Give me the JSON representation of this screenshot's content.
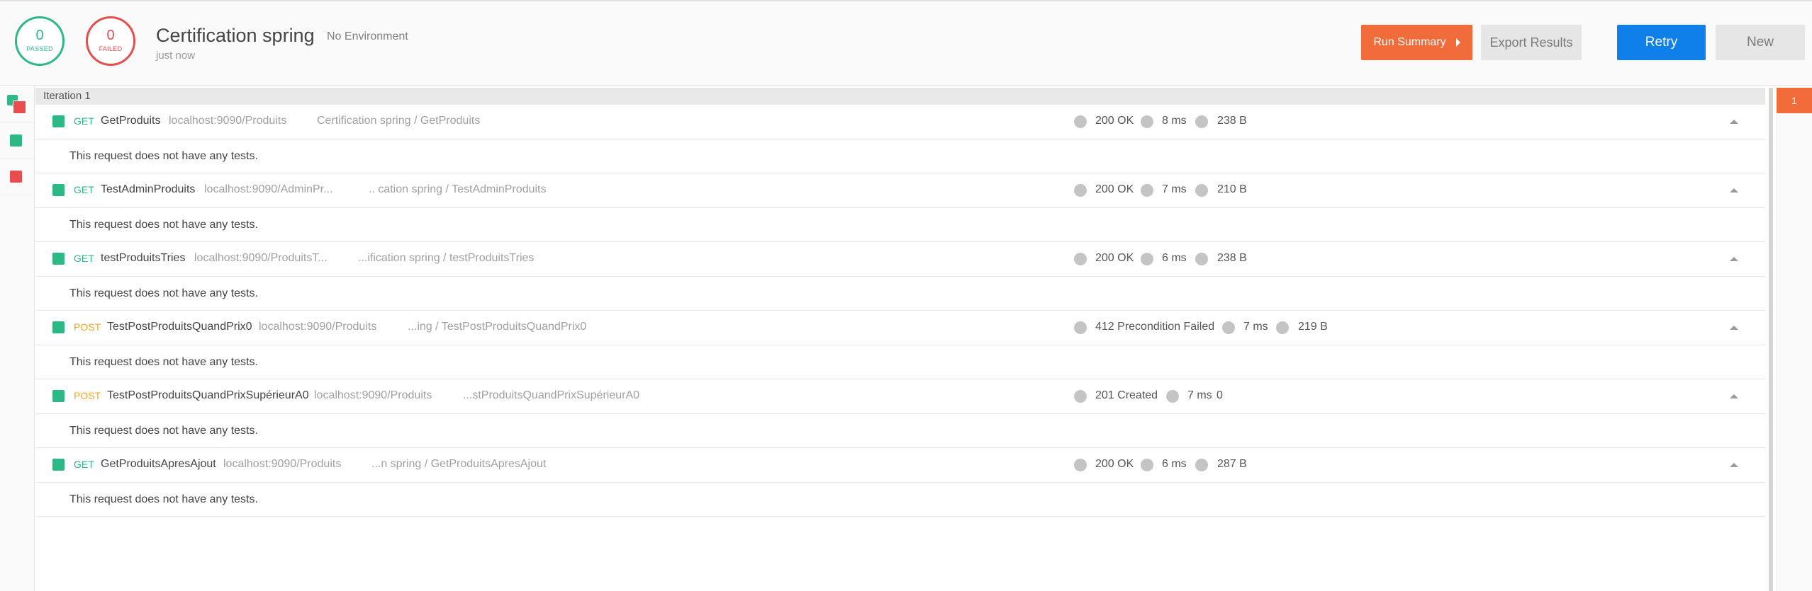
{
  "summary": {
    "passed_count": "0",
    "passed_label": "PASSED",
    "failed_count": "0",
    "failed_label": "FAILED",
    "title": "Certification spring",
    "environment": "No Environment",
    "time": "just now"
  },
  "toolbar": {
    "run_summary": "Run Summary",
    "export_results": "Export Results",
    "retry": "Retry",
    "new": "New"
  },
  "iteration": {
    "label": "Iteration 1",
    "badge": "1"
  },
  "requests": [
    {
      "method": "GET",
      "name": "GetProduits",
      "url": "localhost:9090/Produits",
      "path": "Certification spring / GetProduits",
      "status": "200 OK",
      "time": "8 ms",
      "size": "238 B",
      "message": "This request does not have any tests."
    },
    {
      "method": "GET",
      "name": "TestAdminProduits",
      "url": "localhost:9090/AdminPr...",
      "path": ".. cation spring / TestAdminProduits",
      "status": "200 OK",
      "time": "7 ms",
      "size": "210 B",
      "message": "This request does not have any tests."
    },
    {
      "method": "GET",
      "name": "testProduitsTries",
      "url": "localhost:9090/ProduitsT...",
      "path": "...ification spring / testProduitsTries",
      "status": "200 OK",
      "time": "6 ms",
      "size": "238 B",
      "message": "This request does not have any tests."
    },
    {
      "method": "POST",
      "name": "TestPostProduitsQuandPrix0",
      "url": "localhost:9090/Produits",
      "path": "...ing / TestPostProduitsQuandPrix0",
      "status": "412 Precondition Failed",
      "time": "7 ms",
      "size": "219 B",
      "message": "This request does not have any tests."
    },
    {
      "method": "POST",
      "name": "TestPostProduitsQuandPrixSupérieurA0",
      "url": "localhost:9090/Produits",
      "path": "...stProduitsQuandPrixSupérieurA0",
      "status": "201 Created",
      "time": "7 ms",
      "size": "0",
      "message": "This request does not have any tests."
    },
    {
      "method": "GET",
      "name": "GetProduitsApresAjout",
      "url": "localhost:9090/Produits",
      "path": "...n spring / GetProduitsApresAjout",
      "status": "200 OK",
      "time": "6 ms",
      "size": "287 B",
      "message": "This request does not have any tests."
    }
  ],
  "colors": {
    "passed": "#2eb886",
    "failed": "#e84c4c",
    "accent": "#f26b3a",
    "primary": "#0f80ea",
    "get": "#2eb886",
    "post": "#f5a623"
  }
}
